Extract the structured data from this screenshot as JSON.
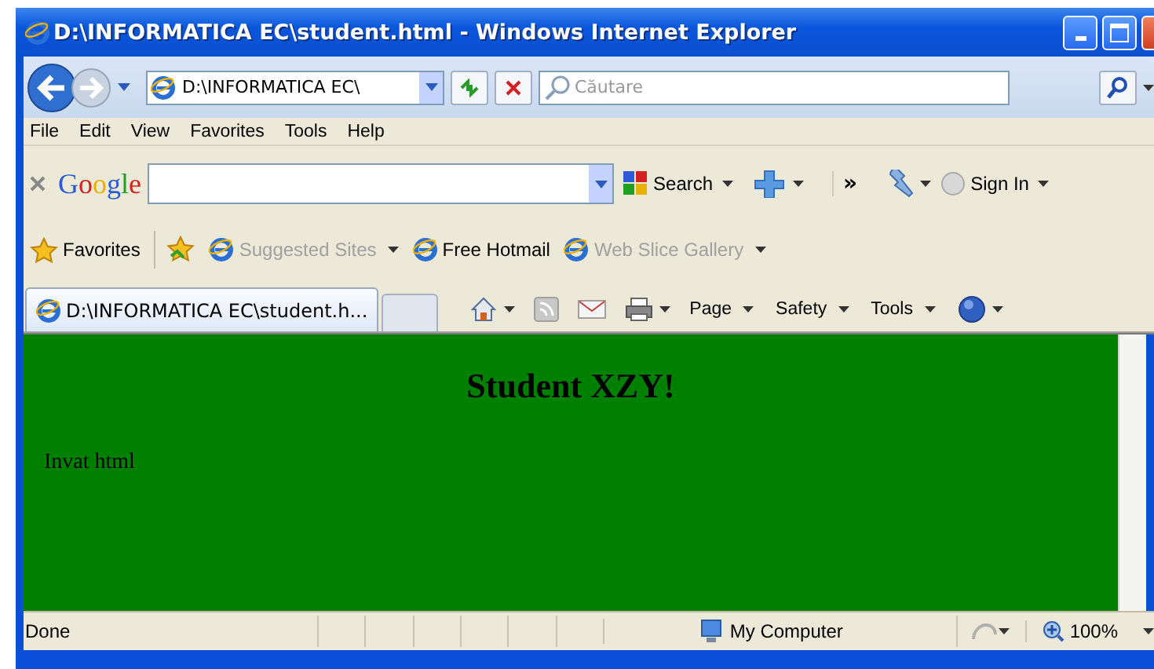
{
  "window": {
    "title": "D:\\INFORMATICA EC\\student.html - Windows Internet Explorer"
  },
  "address": {
    "value": "D:\\INFORMATICA EC\\"
  },
  "search": {
    "placeholder": "Căutare"
  },
  "menu": [
    "File",
    "Edit",
    "View",
    "Favorites",
    "Tools",
    "Help"
  ],
  "google_toolbar": {
    "logo": "Google",
    "search_label": "Search",
    "chevron": "»",
    "sign_in": "Sign In"
  },
  "favorites_bar": {
    "label": "Favorites",
    "links": [
      {
        "label": "Suggested Sites",
        "dimmed": true,
        "dropdown": true
      },
      {
        "label": "Free Hotmail",
        "dimmed": false,
        "dropdown": false
      },
      {
        "label": "Web Slice Gallery",
        "dimmed": true,
        "dropdown": true
      }
    ]
  },
  "tabs": [
    {
      "label": "D:\\INFORMATICA EC\\student.h...",
      "selected": true
    }
  ],
  "command_bar": [
    "Page",
    "Safety",
    "Tools"
  ],
  "content": {
    "heading": "Student XZY!",
    "paragraph": "Invat html"
  },
  "status_bar": {
    "text": "Done",
    "zone": "My Computer",
    "zoom": "100%"
  }
}
